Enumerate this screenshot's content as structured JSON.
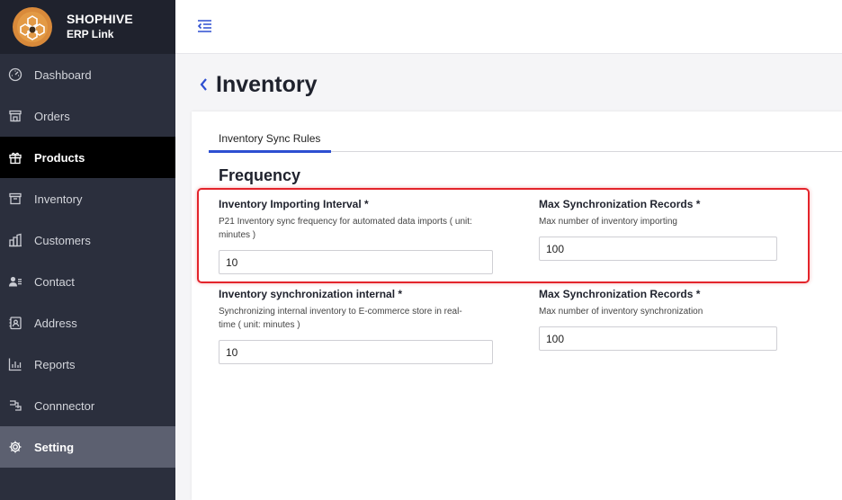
{
  "brand": {
    "name": "SHOPHIVE",
    "subtitle": "ERP Link"
  },
  "sidebar": {
    "items": [
      {
        "label": "Dashboard",
        "icon": "dashboard-icon"
      },
      {
        "label": "Orders",
        "icon": "store-icon"
      },
      {
        "label": "Products",
        "icon": "gift-icon",
        "active": true
      },
      {
        "label": "Inventory",
        "icon": "inventory-box-icon"
      },
      {
        "label": "Customers",
        "icon": "building-icon"
      },
      {
        "label": "Contact",
        "icon": "contact-icon"
      },
      {
        "label": "Address",
        "icon": "address-icon"
      },
      {
        "label": "Reports",
        "icon": "bar-chart-icon"
      },
      {
        "label": "Connnector",
        "icon": "connector-icon"
      },
      {
        "label": "Setting",
        "icon": "gear-icon",
        "active": true
      }
    ]
  },
  "header": {
    "menu_toggle_icon": "menu-collapse-icon"
  },
  "page": {
    "title": "Inventory",
    "back_icon": "chevron-left-icon"
  },
  "tabs": [
    {
      "label": "Inventory Sync Rules",
      "active": true
    }
  ],
  "section": {
    "title": "Frequency"
  },
  "fields": {
    "importing_interval": {
      "label": "Inventory Importing Interval *",
      "help_line1": "P21 Inventory sync frequency for automated data imports ( unit:",
      "help_line2": "minutes )",
      "value": "10"
    },
    "max_import_records": {
      "label": "Max Synchronization Records *",
      "help": "Max number of inventory importing",
      "value": "100"
    },
    "sync_interval": {
      "label": "Inventory synchronization internal *",
      "help_line1": "Synchronizing internal inventory to E-commerce store in real-",
      "help_line2": "time ( unit: minutes )",
      "value": "10"
    },
    "max_sync_records": {
      "label": "Max Synchronization Records *",
      "help": "Max number of inventory synchronization",
      "value": "100"
    }
  },
  "colors": {
    "sidebar_bg": "#2b2f3d",
    "brand_bg": "#1f222d",
    "accent": "#2d4fd1",
    "highlight": "#e3242b",
    "active_item_bg": "#000000",
    "setting_item_bg": "#5c6070"
  }
}
